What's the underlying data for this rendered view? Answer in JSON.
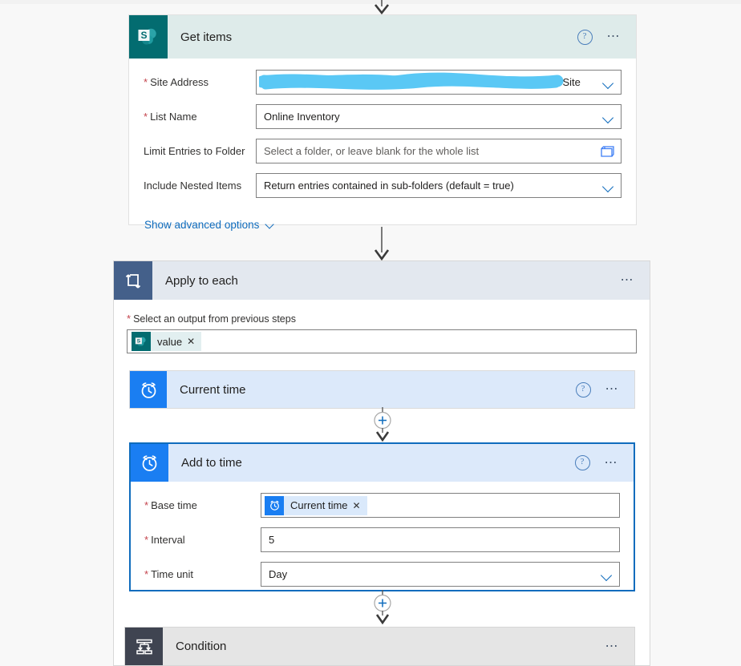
{
  "canvas": {
    "background": "#f8f8f8"
  },
  "colors": {
    "sharepoint_teal": "#036c70",
    "loop_slate": "#44608a",
    "clock_blue": "#1a7ef2",
    "condition_slate": "#3f4451",
    "accent_blue": "#0f6cbd",
    "selected_border": "#0f6cbd",
    "required_red": "#c4444d",
    "redaction_blue": "#5ac8f5"
  },
  "steps": [
    {
      "id": "get-items",
      "title": "Get items",
      "icon": "sharepoint-icon",
      "header_bg": "#deebea",
      "help_icon": "help-icon",
      "menu_icon": "ellipsis-icon",
      "fields": [
        {
          "label": "Site Address",
          "required": true,
          "value": "/JiaoSite",
          "redacted": true,
          "control": "dropdown"
        },
        {
          "label": "List Name",
          "required": true,
          "value": "Online Inventory",
          "control": "dropdown"
        },
        {
          "label": "Limit Entries to Folder",
          "required": false,
          "placeholder": "Select a folder, or leave blank for the whole list",
          "control": "folder-picker"
        },
        {
          "label": "Include Nested Items",
          "required": false,
          "value": "Return entries contained in sub-folders (default = true)",
          "control": "dropdown"
        }
      ],
      "advanced_options_label": "Show advanced options"
    }
  ],
  "loop": {
    "title": "Apply to each",
    "icon": "loop-icon",
    "menu_icon": "ellipsis-icon",
    "select_output_label": "Select an output from previous steps",
    "select_output_required": true,
    "token": {
      "label": "value",
      "icon": "sharepoint-icon",
      "remove_label": "✕"
    },
    "children": [
      {
        "id": "current-time",
        "title": "Current time",
        "icon": "clock-icon",
        "header_bg": "#dce9fa",
        "selected": false,
        "help_icon": "help-icon",
        "menu_icon": "ellipsis-icon"
      },
      {
        "id": "add-to-time",
        "title": "Add to time",
        "icon": "clock-icon",
        "header_bg": "#dce9fa",
        "selected": true,
        "help_icon": "help-icon",
        "menu_icon": "ellipsis-icon",
        "fields": [
          {
            "label": "Base time",
            "required": true,
            "control": "token",
            "token": {
              "label": "Current time",
              "icon": "clock-icon",
              "remove_label": "✕"
            }
          },
          {
            "label": "Interval",
            "required": true,
            "value": "5",
            "control": "text"
          },
          {
            "label": "Time unit",
            "required": true,
            "value": "Day",
            "control": "dropdown"
          }
        ]
      },
      {
        "id": "condition",
        "title": "Condition",
        "icon": "condition-icon",
        "header_bg": "#e5e5e5",
        "menu_icon": "ellipsis-icon"
      }
    ]
  },
  "connectors": {
    "add_step_label": "+",
    "arrow_label": "↓"
  }
}
